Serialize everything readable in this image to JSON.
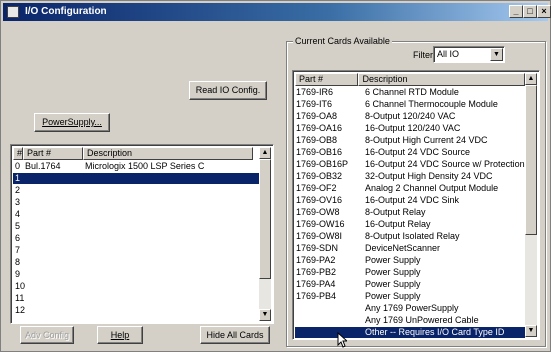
{
  "window": {
    "title": "I/O Configuration",
    "controls": {
      "minimize": "_",
      "maximize": "□",
      "close": "×"
    }
  },
  "buttons": {
    "read_io_config": "Read IO Config.",
    "power_supply": "PowerSupply...",
    "adv_config": "Adv Config",
    "help": "Help",
    "hide_all_cards": "Hide All Cards"
  },
  "available": {
    "group_label": "Current Cards Available",
    "filter_label": "Filter",
    "filter_value": "All IO",
    "columns": [
      "Part #",
      "Description"
    ],
    "rows": [
      [
        "1769-IR6",
        "6 Channel RTD Module"
      ],
      [
        "1769-IT6",
        "6 Channel Thermocouple Module"
      ],
      [
        "1769-OA8",
        "8-Output 120/240 VAC"
      ],
      [
        "1769-OA16",
        "16-Output 120/240 VAC"
      ],
      [
        "1769-OB8",
        "8-Output High Current 24 VDC"
      ],
      [
        "1769-OB16",
        "16-Output 24 VDC Source"
      ],
      [
        "1769-OB16P",
        "16-Output 24 VDC Source w/ Protection"
      ],
      [
        "1769-OB32",
        "32-Output High Density 24 VDC"
      ],
      [
        "1769-OF2",
        "Analog  2 Channel Output Module"
      ],
      [
        "1769-OV16",
        "16-Output 24 VDC Sink"
      ],
      [
        "1769-OW8",
        "8-Output Relay"
      ],
      [
        "1769-OW16",
        "16-Output Relay"
      ],
      [
        "1769-OW8I",
        "8-Output Isolated Relay"
      ],
      [
        "1769-SDN",
        "DeviceNetScanner"
      ],
      [
        "1769-PA2",
        "Power Supply"
      ],
      [
        "1769-PB2",
        "Power Supply"
      ],
      [
        "1769-PA4",
        "Power Supply"
      ],
      [
        "1769-PB4",
        "Power Supply"
      ],
      [
        "",
        "Any 1769 PowerSupply"
      ],
      [
        "",
        "Any 1769 UnPowered Cable"
      ],
      [
        "",
        "Other -- Requires I/O Card Type ID"
      ]
    ],
    "selected_index": 20
  },
  "configured": {
    "columns": [
      "#",
      "Part #",
      "Description"
    ],
    "rows": [
      [
        "0",
        "Bul.1764",
        "Micrologix 1500 LSP Series C"
      ],
      [
        "1",
        "",
        ""
      ],
      [
        "2",
        "",
        ""
      ],
      [
        "3",
        "",
        ""
      ],
      [
        "4",
        "",
        ""
      ],
      [
        "5",
        "",
        ""
      ],
      [
        "6",
        "",
        ""
      ],
      [
        "7",
        "",
        ""
      ],
      [
        "8",
        "",
        ""
      ],
      [
        "9",
        "",
        ""
      ],
      [
        "10",
        "",
        ""
      ],
      [
        "11",
        "",
        ""
      ],
      [
        "12",
        "",
        ""
      ]
    ],
    "selected_index": 1
  },
  "icons": {
    "scroll_up": "▲",
    "scroll_down": "▼",
    "dropdown": "▼"
  }
}
